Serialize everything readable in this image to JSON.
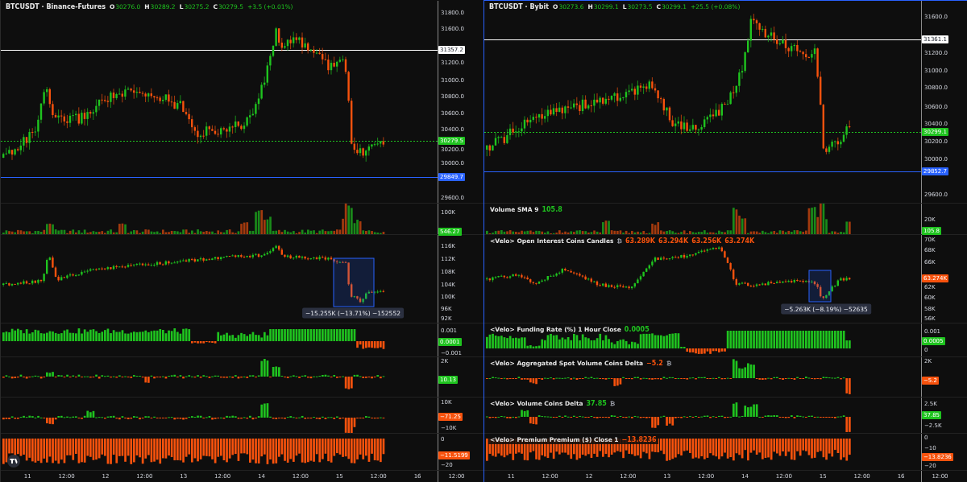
{
  "charts": [
    {
      "selected": false,
      "header": {
        "title": "BTCUSDT · Binance-Futures",
        "ohlc": [
          {
            "label": "O",
            "value": "30276.0"
          },
          {
            "label": "H",
            "value": "30289.2"
          },
          {
            "label": "L",
            "value": "30275.2"
          },
          {
            "label": "C",
            "value": "30279.5"
          }
        ],
        "change": "+3.5 (+0.01%)"
      },
      "panes": [
        {
          "kind": "price",
          "axis": [
            {
              "kind": "tick",
              "text": "31800.0"
            },
            {
              "kind": "tick",
              "text": "31600.0"
            },
            {
              "kind": "tag",
              "text": "31357.2",
              "color": "#ffffff",
              "line": true,
              "dashed": false
            },
            {
              "kind": "tick",
              "text": "31200.0"
            },
            {
              "kind": "tick",
              "text": "31000.0"
            },
            {
              "kind": "tick",
              "text": "30800.0"
            },
            {
              "kind": "tick",
              "text": "30600.0"
            },
            {
              "kind": "tick",
              "text": "30400.0"
            },
            {
              "kind": "tag",
              "text": "30279.5",
              "color": "#1fc31f",
              "line": true,
              "dashed": true
            },
            {
              "kind": "tick",
              "text": "30200.0"
            },
            {
              "kind": "tick",
              "text": "30000.0"
            },
            {
              "kind": "tag",
              "text": "29849.7",
              "color": "#2962ff",
              "line": true,
              "dashed": false
            },
            {
              "kind": "tick",
              "text": "29600.0"
            }
          ]
        },
        {
          "kind": "volume",
          "axis": [
            {
              "kind": "tick",
              "text": "100K"
            },
            {
              "kind": "tag",
              "text": "546.27",
              "color": "#1fc31f"
            }
          ]
        },
        {
          "kind": "candles",
          "axis": [
            {
              "kind": "tick",
              "text": "116K"
            },
            {
              "kind": "tick",
              "text": "112K"
            },
            {
              "kind": "tick",
              "text": "108K"
            },
            {
              "kind": "tick",
              "text": "104K"
            },
            {
              "kind": "tick",
              "text": "100K"
            },
            {
              "kind": "tick",
              "text": "96K"
            },
            {
              "kind": "tick",
              "text": "92K"
            }
          ],
          "measure": {
            "label": "−15.255K (−13.71%) −152552"
          }
        },
        {
          "kind": "histogram",
          "axis": [
            {
              "kind": "tick",
              "text": "0.001"
            },
            {
              "kind": "tag",
              "text": "0.0001",
              "color": "#1fc31f"
            },
            {
              "kind": "tick",
              "text": "−0.001"
            }
          ]
        },
        {
          "kind": "histogram",
          "axis": [
            {
              "kind": "tick",
              "text": "2K"
            },
            {
              "kind": "tag",
              "text": "10.13",
              "color": "#1fc31f"
            }
          ]
        },
        {
          "kind": "histogram",
          "axis": [
            {
              "kind": "tick",
              "text": "10K"
            },
            {
              "kind": "tag",
              "text": "−71.25",
              "color": "#f7520d"
            },
            {
              "kind": "tick",
              "text": "−10K"
            }
          ]
        },
        {
          "kind": "premium",
          "axis": [
            {
              "kind": "tick",
              "text": "0"
            },
            {
              "kind": "tag",
              "text": "−11.5199",
              "color": "#f7520d"
            },
            {
              "kind": "tick",
              "text": "−20"
            }
          ]
        }
      ],
      "time_labels": [
        "11",
        "12:00",
        "12",
        "12:00",
        "13",
        "12:00",
        "14",
        "12:00",
        "15",
        "12:00",
        "16",
        "12:00"
      ]
    },
    {
      "selected": true,
      "header": {
        "title": "BTCUSDT · Bybit",
        "ohlc": [
          {
            "label": "O",
            "value": "30273.6"
          },
          {
            "label": "H",
            "value": "30299.1"
          },
          {
            "label": "L",
            "value": "30273.5"
          },
          {
            "label": "C",
            "value": "30299.1"
          }
        ],
        "change": "+25.5 (+0.08%)"
      },
      "panes": [
        {
          "kind": "price",
          "axis": [
            {
              "kind": "tick",
              "text": "31600.0"
            },
            {
              "kind": "tag",
              "text": "31361.1",
              "color": "#ffffff",
              "line": true,
              "dashed": false
            },
            {
              "kind": "tick",
              "text": "31200.0"
            },
            {
              "kind": "tick",
              "text": "31000.0"
            },
            {
              "kind": "tick",
              "text": "30800.0"
            },
            {
              "kind": "tick",
              "text": "30600.0"
            },
            {
              "kind": "tick",
              "text": "30400.0"
            },
            {
              "kind": "tag",
              "text": "30299.1",
              "color": "#1fc31f",
              "line": true,
              "dashed": true
            },
            {
              "kind": "tick",
              "text": "30200.0"
            },
            {
              "kind": "tick",
              "text": "30000.0"
            },
            {
              "kind": "tag",
              "text": "29852.7",
              "color": "#2962ff",
              "line": true,
              "dashed": false
            },
            {
              "kind": "tick",
              "text": "29600.0"
            }
          ]
        },
        {
          "kind": "volume",
          "legend": {
            "title": "Volume SMA 9",
            "parts": [
              {
                "text": "105.8",
                "color": "#1fc31f"
              }
            ]
          },
          "axis": [
            {
              "kind": "tick",
              "text": "20K"
            },
            {
              "kind": "tag",
              "text": "105.8",
              "color": "#1fc31f"
            }
          ]
        },
        {
          "kind": "candles",
          "legend": {
            "title": "<Velo> Open Interest Coins Candles",
            "parts": [
              {
                "text": "₿",
                "color": "#9598a1"
              },
              {
                "text": "63.289K",
                "color": "#f7520d"
              },
              {
                "text": "63.294K",
                "color": "#f7520d"
              },
              {
                "text": "63.256K",
                "color": "#f7520d"
              },
              {
                "text": "63.274K",
                "color": "#f7520d"
              }
            ]
          },
          "axis": [
            {
              "kind": "tick",
              "text": "70K"
            },
            {
              "kind": "tick",
              "text": "68K"
            },
            {
              "kind": "tick",
              "text": "66K"
            },
            {
              "kind": "tag",
              "text": "63.274K",
              "color": "#f7520d"
            },
            {
              "kind": "tick",
              "text": "62K"
            },
            {
              "kind": "tick",
              "text": "60K"
            },
            {
              "kind": "tick",
              "text": "58K"
            },
            {
              "kind": "tick",
              "text": "56K"
            }
          ],
          "measure": {
            "label": "−5.263K (−8.19%) −52635"
          }
        },
        {
          "kind": "histogram",
          "legend": {
            "title": "<Velo> Funding Rate (%) 1 Hour Close",
            "parts": [
              {
                "text": "0.0005",
                "color": "#1fc31f"
              }
            ]
          },
          "axis": [
            {
              "kind": "tick",
              "text": "0.001"
            },
            {
              "kind": "tag",
              "text": "0.0005",
              "color": "#1fc31f"
            },
            {
              "kind": "tick",
              "text": "0"
            }
          ]
        },
        {
          "kind": "histogram",
          "legend": {
            "title": "<Velo> Aggregated Spot Volume Coins Delta",
            "parts": [
              {
                "text": "−5.2",
                "color": "#f7520d"
              },
              {
                "text": "₿",
                "color": "#9598a1"
              }
            ]
          },
          "axis": [
            {
              "kind": "tick",
              "text": "2K"
            },
            {
              "kind": "tag",
              "text": "−5.2",
              "color": "#f7520d"
            }
          ]
        },
        {
          "kind": "histogram",
          "legend": {
            "title": "<Velo> Volume Coins Delta",
            "parts": [
              {
                "text": "37.85",
                "color": "#1fc31f"
              },
              {
                "text": "₿",
                "color": "#9598a1"
              }
            ]
          },
          "axis": [
            {
              "kind": "tick",
              "text": "2.5K"
            },
            {
              "kind": "tag",
              "text": "37.85",
              "color": "#1fc31f"
            },
            {
              "kind": "tick",
              "text": "−2.5K"
            }
          ]
        },
        {
          "kind": "premium",
          "legend": {
            "title": "<Velo> Premium Premium ($) Close 1",
            "parts": [
              {
                "text": "−13.8236",
                "color": "#f7520d"
              }
            ]
          },
          "axis": [
            {
              "kind": "tick",
              "text": "0"
            },
            {
              "kind": "tick",
              "text": "−10"
            },
            {
              "kind": "tag",
              "text": "−13.8236",
              "color": "#f7520d"
            },
            {
              "kind": "tick",
              "text": "−20"
            }
          ]
        }
      ],
      "time_labels": [
        "11",
        "12:00",
        "12",
        "12:00",
        "13",
        "12:00",
        "14",
        "12:00",
        "15",
        "12:00",
        "16",
        "12:00"
      ]
    }
  ]
}
